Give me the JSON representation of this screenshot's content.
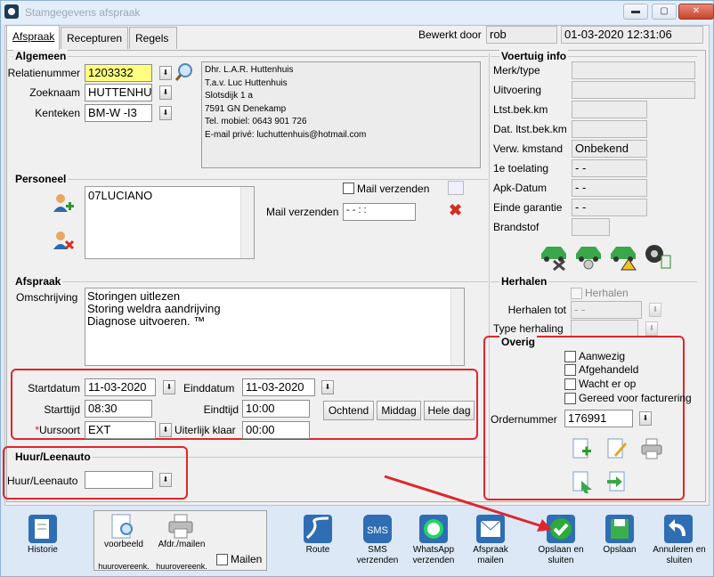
{
  "window": {
    "title": "Stamgegevens afspraak",
    "minimize": "▬",
    "maximize": "▢",
    "close": "✕"
  },
  "tabs": [
    {
      "label": "Afspraak"
    },
    {
      "label": "Recepturen"
    },
    {
      "label": "Regels"
    }
  ],
  "header": {
    "edited_by_label": "Bewerkt door",
    "edited_by": "rob",
    "datetime": "01-03-2020 12:31:06"
  },
  "algemeen": {
    "title": "Algemeen",
    "relatie_label": "Relatienummer",
    "relatie": "1203332",
    "zoeknaam_label": "Zoeknaam",
    "zoeknaam": "HUTTENHU1",
    "kenteken_label": "Kenteken",
    "kenteken": "BM-W -I3",
    "address": [
      "Dhr. L.A.R. Huttenhuis",
      "T.a.v. Luc Huttenhuis",
      "Slotsdijk 1 a",
      "7591 GN  Denekamp",
      "Tel. mobiel: 0643 901 726",
      "E-mail privé: luchuttenhuis@hotmail.com"
    ]
  },
  "personeel": {
    "title": "Personeel",
    "employee": "07LUCIANO",
    "mail_check_label": "Mail verzenden",
    "mail_label": "Mail verzenden",
    "mail_value": "-  -          :  :"
  },
  "afspraak": {
    "title": "Afspraak",
    "omschrijving_label": "Omschrijving",
    "omschrijving": [
      "Storingen uitlezen",
      "Storing weldra aandrijving",
      "Diagnose uitvoeren. ™"
    ],
    "startdatum_label": "Startdatum",
    "startdatum": "11-03-2020",
    "einddatum_label": "Einddatum",
    "einddatum": "11-03-2020",
    "starttijd_label": "Starttijd",
    "starttijd": "08:30",
    "eindtijd_label": "Eindtijd",
    "eindtijd": "10:00",
    "ochtend": "Ochtend",
    "middag": "Middag",
    "heledag": "Hele dag",
    "uursoort_label": "Uursoort",
    "uursoort_star": "*",
    "uursoort": "EXT",
    "uiterlijk_label": "Uiterlijk klaar",
    "uiterlijk": "00:00"
  },
  "huur": {
    "title": "Huur/Leenauto",
    "label": "Huur/Leenauto",
    "value": ""
  },
  "voertuig": {
    "title": "Voertuig info",
    "rows": [
      {
        "label": "Merk/type",
        "value": ""
      },
      {
        "label": "Uitvoering",
        "value": ""
      },
      {
        "label": "Ltst.bek.km",
        "value": ""
      },
      {
        "label": "Dat. ltst.bek.km",
        "value": ""
      },
      {
        "label": "Verw. kmstand",
        "value": "Onbekend"
      },
      {
        "label": "1e toelating",
        "value": "-  -"
      },
      {
        "label": "Apk-Datum",
        "value": "-  -"
      },
      {
        "label": "Einde garantie",
        "value": "-  -"
      },
      {
        "label": "Brandstof",
        "value": ""
      }
    ]
  },
  "herhalen": {
    "title": "Herhalen",
    "check_label": "Herhalen",
    "tot_label": "Herhalen tot",
    "tot_value": "-  -",
    "type_label": "Type herhaling",
    "type_value": ""
  },
  "overig": {
    "title": "Overig",
    "checks": [
      "Aanwezig",
      "Afgehandeld",
      "Wacht er op",
      "Gereed voor facturering"
    ],
    "order_label": "Ordernummer",
    "order": "176991"
  },
  "toolbar": {
    "historie": "Historie",
    "voorbeeld": "voorbeeld",
    "afdr": "Afdr./mailen",
    "huur1": "huurovereenk.",
    "huur2": "huurovereenk.",
    "mailen": "Mailen",
    "route": "Route",
    "sms": "SMS verzenden",
    "whatsapp": "WhatsApp verzenden",
    "afspraakmailen": "Afspraak mailen",
    "opslaan_sluiten": "Opslaan en sluiten",
    "opslaan": "Opslaan",
    "annuleren": "Annuleren en sluiten"
  },
  "colors": {
    "highlight": "#e0262b",
    "yellow_field": "#ffff80"
  }
}
